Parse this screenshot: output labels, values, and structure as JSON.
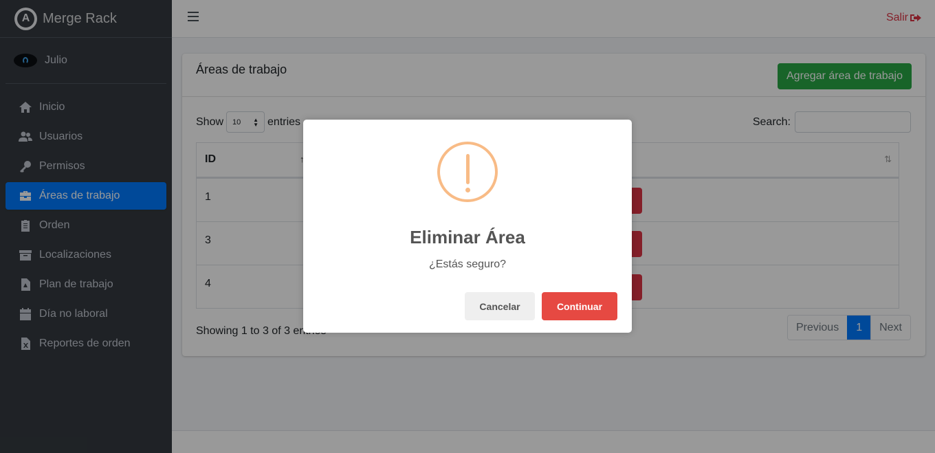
{
  "brand": {
    "name": "Merge Rack",
    "logo_letter": "A"
  },
  "user": {
    "name": "Julio"
  },
  "sidebar": {
    "items": [
      {
        "label": "Inicio",
        "icon": "home-icon",
        "active": false
      },
      {
        "label": "Usuarios",
        "icon": "users-icon",
        "active": false
      },
      {
        "label": "Permisos",
        "icon": "key-icon",
        "active": false
      },
      {
        "label": "Áreas de trabajo",
        "icon": "briefcase-icon",
        "active": true
      },
      {
        "label": "Orden",
        "icon": "clipboard-icon",
        "active": false
      },
      {
        "label": "Localizaciones",
        "icon": "archive-icon",
        "active": false
      },
      {
        "label": "Plan de trabajo",
        "icon": "pdf-file-icon",
        "active": false
      },
      {
        "label": "Día no laboral",
        "icon": "calendar-icon",
        "active": false
      },
      {
        "label": "Reportes de orden",
        "icon": "excel-file-icon",
        "active": false
      }
    ]
  },
  "topbar": {
    "logout_label": "Salir"
  },
  "card": {
    "title": "Áreas de trabajo",
    "add_button": "Agregar área de trabajo"
  },
  "table_controls": {
    "show_label": "Show",
    "entries_label": "entries",
    "length_value": "10",
    "search_label": "Search:"
  },
  "table": {
    "headers": [
      "ID"
    ],
    "rows": [
      {
        "id": "1"
      },
      {
        "id": "3"
      },
      {
        "id": "4"
      }
    ]
  },
  "footer": {
    "info": "Showing 1 to 3 of 3 entries",
    "pagination": {
      "previous": "Previous",
      "current": "1",
      "next": "Next"
    }
  },
  "modal": {
    "title": "Eliminar Área",
    "text": "¿Estás seguro?",
    "cancel_label": "Cancelar",
    "continue_label": "Continuar"
  },
  "colors": {
    "sidebar_bg": "#343a40",
    "active_item": "#007bff",
    "add_button": "#28a745",
    "danger": "#dc3545",
    "warning_icon": "#f8bb86",
    "continue_button": "#e64942"
  }
}
